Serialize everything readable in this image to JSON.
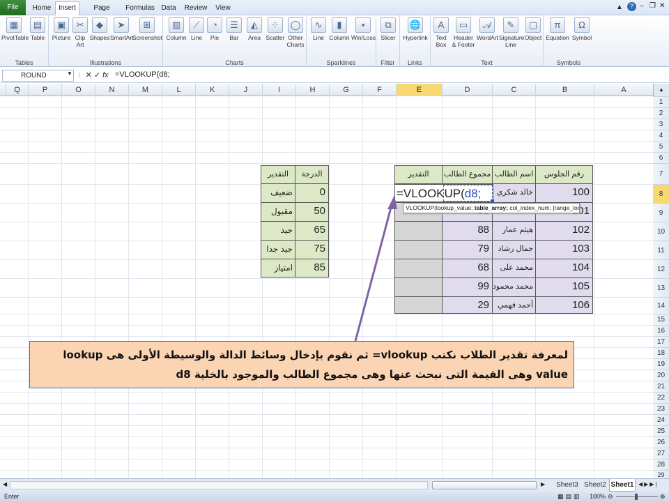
{
  "ribbon_tabs": [
    "File",
    "Home",
    "Insert",
    "Page Layout",
    "Formulas",
    "Data",
    "Review",
    "View"
  ],
  "active_tab": "Insert",
  "ribbon_groups": [
    {
      "label": "Tables",
      "buttons": [
        "PivotTable",
        "Table"
      ]
    },
    {
      "label": "Illustrations",
      "buttons": [
        "Picture",
        "Clip Art",
        "Shapes",
        "SmartArt",
        "Screenshot"
      ]
    },
    {
      "label": "Charts",
      "buttons": [
        "Column",
        "Line",
        "Pie",
        "Bar",
        "Area",
        "Scatter",
        "Other Charts"
      ]
    },
    {
      "label": "Sparklines",
      "buttons": [
        "Line",
        "Column",
        "Win/Loss"
      ]
    },
    {
      "label": "Filter",
      "buttons": [
        "Slicer"
      ]
    },
    {
      "label": "Links",
      "buttons": [
        "Hyperlink"
      ]
    },
    {
      "label": "Text",
      "buttons": [
        "Text Box",
        "Header & Footer",
        "WordArt",
        "Signature Line",
        "Object"
      ]
    },
    {
      "label": "Symbols",
      "buttons": [
        "Equation",
        "Symbol"
      ]
    }
  ],
  "name_box": "ROUND",
  "formula_bar": "=VLOOKUP(d8;",
  "columns": [
    "Q",
    "P",
    "O",
    "N",
    "M",
    "L",
    "K",
    "J",
    "I",
    "H",
    "G",
    "F",
    "E",
    "D",
    "C",
    "B",
    "A"
  ],
  "selected_column": "E",
  "rows": [
    "1",
    "2",
    "3",
    "4",
    "5",
    "6",
    "7",
    "8",
    "9",
    "10",
    "11",
    "12",
    "13",
    "14",
    "15",
    "16",
    "17",
    "18",
    "19",
    "20",
    "21",
    "22",
    "23",
    "24",
    "25",
    "26",
    "27",
    "28",
    "29"
  ],
  "selected_row": "8",
  "grade_table": {
    "headers": {
      "score": "الدرجة",
      "grade": "التقدير"
    },
    "rows": [
      {
        "score": "0",
        "grade": "ضعيف"
      },
      {
        "score": "50",
        "grade": "مقبول"
      },
      {
        "score": "65",
        "grade": "جيد"
      },
      {
        "score": "75",
        "grade": "جيد جدا"
      },
      {
        "score": "85",
        "grade": "امتياز"
      }
    ]
  },
  "student_table": {
    "headers": {
      "seat": "رقم الجلوس",
      "name": "اسم الطالب",
      "total": "مجموع الطالب",
      "grade": "التقدير"
    },
    "rows": [
      {
        "seat": "100",
        "name": "خالد شكري",
        "total": "",
        "grade": ""
      },
      {
        "seat": "101",
        "name": "",
        "total": "50",
        "grade": ""
      },
      {
        "seat": "102",
        "name": "هيثم عمار",
        "total": "88",
        "grade": ""
      },
      {
        "seat": "103",
        "name": "جمال رشاد",
        "total": "79",
        "grade": ""
      },
      {
        "seat": "104",
        "name": "محمد على",
        "total": "68",
        "grade": ""
      },
      {
        "seat": "105",
        "name": "محمد محمود",
        "total": "99",
        "grade": ""
      },
      {
        "seat": "106",
        "name": "أحمد فهمي",
        "total": "29",
        "grade": ""
      }
    ]
  },
  "editing_cell": {
    "prefix": "=VLOOKUP(",
    "ref": "d8;"
  },
  "tooltip": {
    "func": "VLOOKUP(lookup_value;",
    "bold": "table_array;",
    "rest": "col_index_num; [range_lookup])"
  },
  "sheet_tabs": [
    "Sheet3",
    "Sheet2",
    "Sheet1"
  ],
  "active_sheet": "Sheet1",
  "status_left": "Enter",
  "zoom": "100%",
  "callout_text": "لمعرفة تقدير الطلاب نكتب vlookup= ثم نقوم بإدخال وسائط الدالة والوسيطة الأولى هى lookup value وهى القيمة التى نبحث عنها وهى مجموع الطالب والموجود بالخلية d8",
  "colors": {
    "header_green": "#dde9c6",
    "lavender": "#e1dced",
    "gray": "#d6d6d6",
    "callout": "#fbd4b4",
    "arrow": "#8064a2",
    "selection": "#f8d870"
  }
}
